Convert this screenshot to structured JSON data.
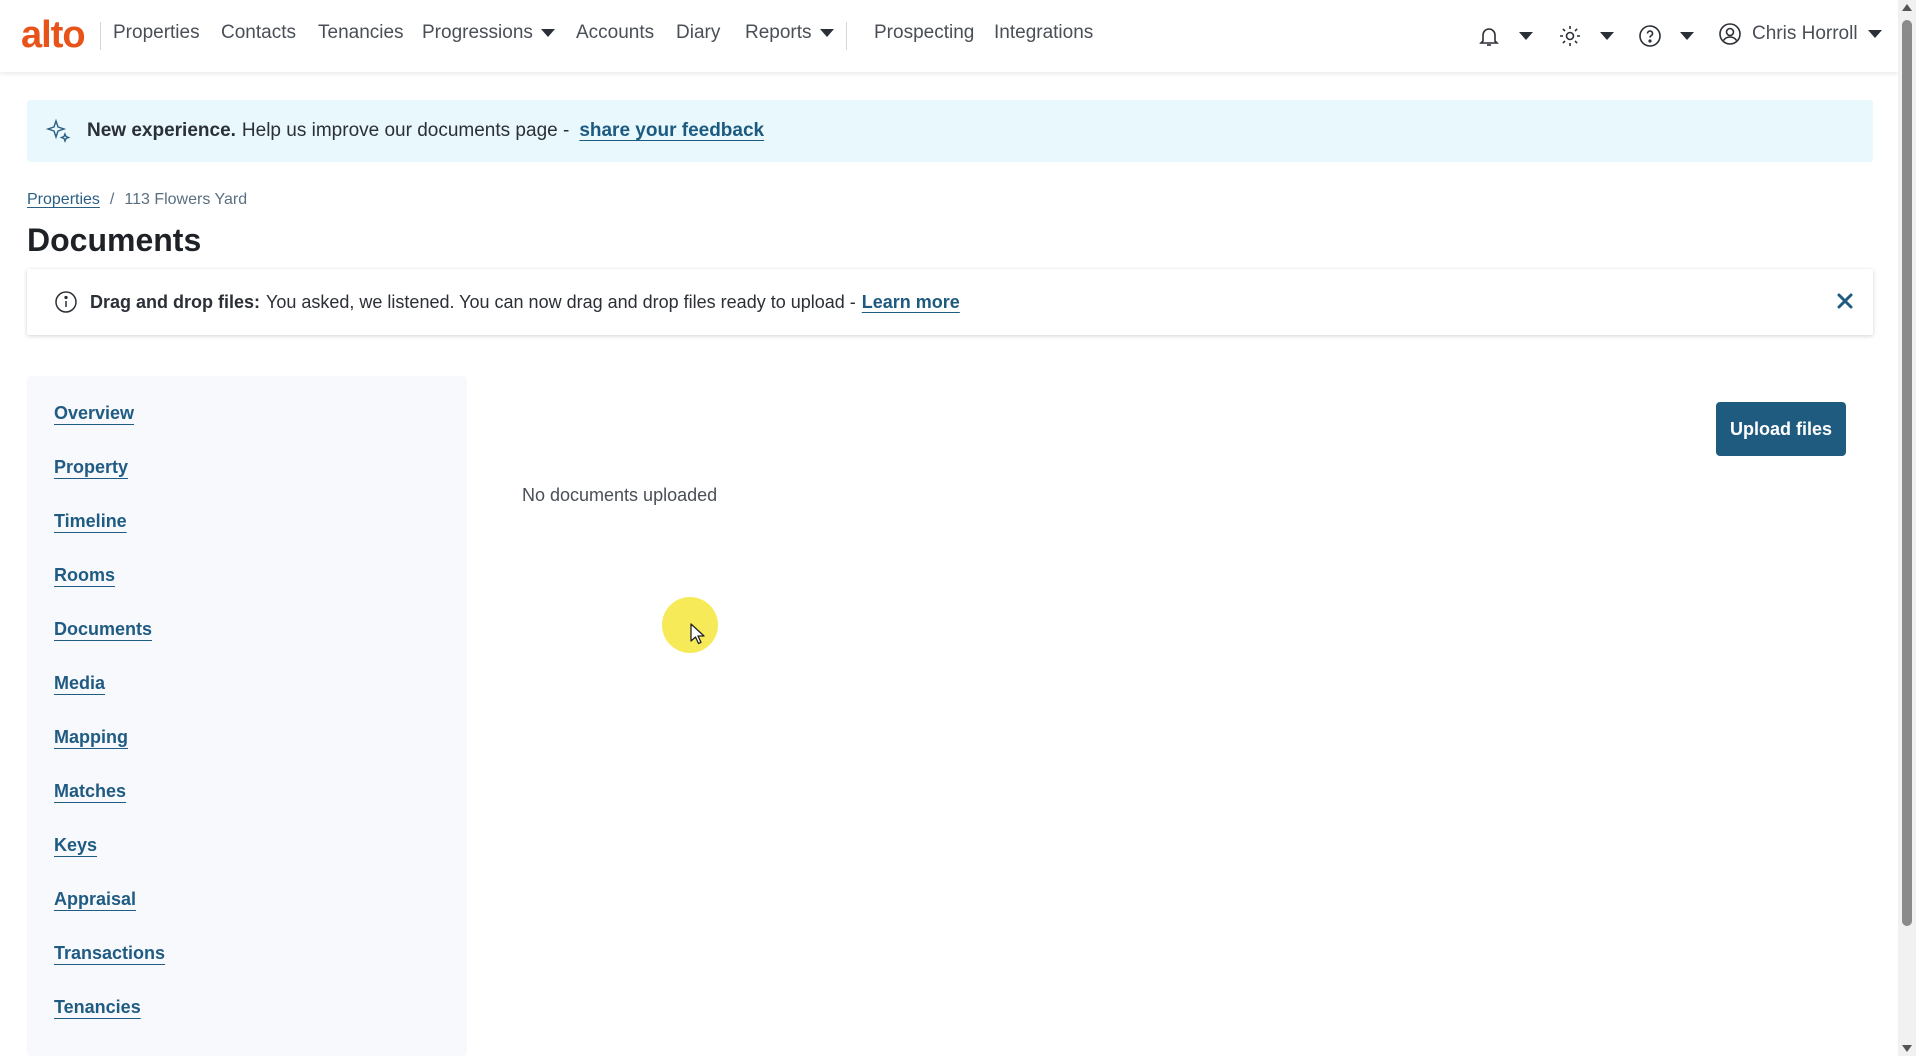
{
  "nav": {
    "logo": "alto",
    "items": [
      "Properties",
      "Contacts",
      "Tenancies",
      "Progressions",
      "Accounts",
      "Diary",
      "Reports",
      "Prospecting",
      "Integrations"
    ],
    "user_name": "Chris Horroll"
  },
  "feedback_banner": {
    "title": "New experience.",
    "text": "Help us improve our documents page -",
    "link": "share your feedback"
  },
  "breadcrumb": {
    "root": "Properties",
    "separator": "/",
    "current": "113 Flowers Yard"
  },
  "page_title": "Documents",
  "info_banner": {
    "title": "Drag and drop files:",
    "text": "You asked, we listened. You can now drag and drop files ready to upload -",
    "link": "Learn more"
  },
  "sidebar": {
    "items": [
      "Overview",
      "Property",
      "Timeline",
      "Rooms",
      "Documents",
      "Media",
      "Mapping",
      "Matches",
      "Keys",
      "Appraisal",
      "Transactions",
      "Tenancies"
    ]
  },
  "main": {
    "upload_label": "Upload files",
    "empty_text": "No documents uploaded"
  },
  "colors": {
    "brand": "#e8531a",
    "primary": "#1f5a7f",
    "link": "#1f5b82",
    "banner_bg": "#e8f8fd"
  }
}
